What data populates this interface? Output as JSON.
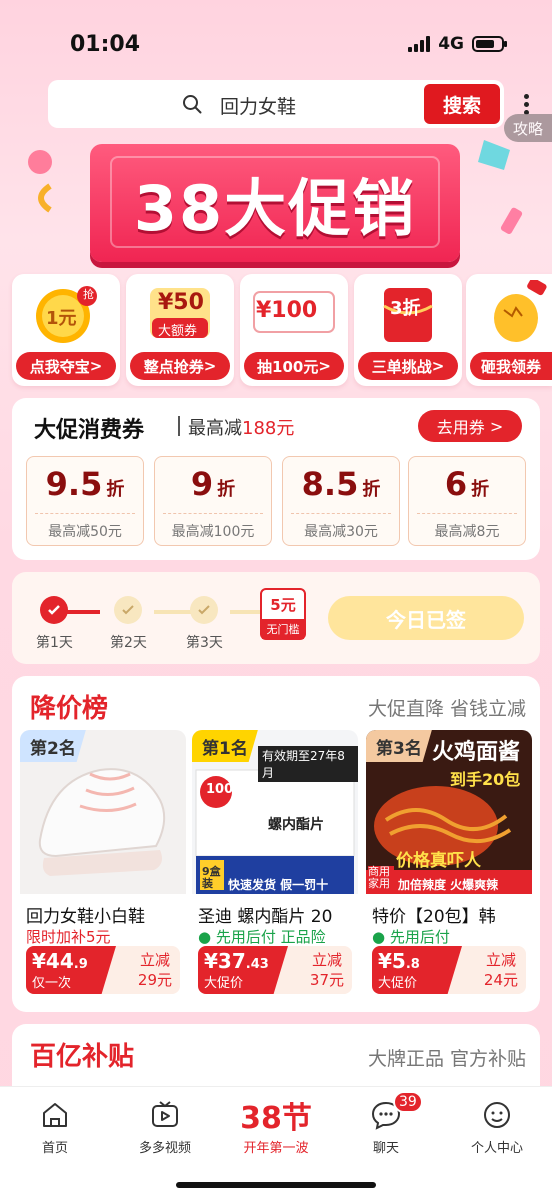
{
  "status": {
    "time": "01:04",
    "network": "4G"
  },
  "search": {
    "query": "回力女鞋",
    "button": "搜索",
    "guide": "攻略"
  },
  "banner": {
    "title": "38大促销"
  },
  "quick_entries": [
    {
      "label": "点我夺宝",
      "icon_text": "1元",
      "icon_sub": "抢",
      "icon": "coin-icon"
    },
    {
      "label": "整点抢券",
      "icon_text": "¥50",
      "icon_sub": "大额券",
      "icon": "coupon-icon"
    },
    {
      "label": "抽100元",
      "icon_text": "¥100",
      "icon": "cash-icon"
    },
    {
      "label": "三单挑战",
      "icon_text": "3折",
      "icon": "red-envelope-icon"
    },
    {
      "label": "砸我领券",
      "icon": "golden-egg-icon"
    }
  ],
  "coupons": {
    "title": "大促消费券",
    "subtitle_prefix": "最高减",
    "subtitle_value": "188元",
    "button": "去用券",
    "items": [
      {
        "discount": "9.5",
        "unit": "折",
        "max": "最高减50元"
      },
      {
        "discount": "9",
        "unit": "折",
        "max": "最高减100元"
      },
      {
        "discount": "8.5",
        "unit": "折",
        "max": "最高减30元"
      },
      {
        "discount": "6",
        "unit": "折",
        "max": "最高减8元"
      }
    ]
  },
  "signin": {
    "days": [
      "第1天",
      "第2天",
      "第3天"
    ],
    "reward_amount": "5元",
    "reward_label": "无门槛",
    "button": "今日已签"
  },
  "ranking": {
    "title": "降价榜",
    "subtitle": "大促直降  省钱立减",
    "products": [
      {
        "rank": "第2名",
        "name": "回力女鞋小白鞋",
        "tag": "限时加补5元",
        "price": "¥44",
        "price_decimal": ".9",
        "price_label": "仅一次",
        "cut_label": "立减",
        "cut_value": "29元"
      },
      {
        "rank": "第1名",
        "name": "圣迪 螺内酯片 20",
        "tag": "先用后付  正品险",
        "price": "¥37",
        "price_decimal": ".43",
        "price_label": "大促价",
        "cut_label": "立减",
        "cut_value": "37元",
        "img_text": "螺内酯片",
        "img_top": "有效期至27年8月",
        "img_badge": "100",
        "img_bottom": "快速发货 假一罚十",
        "img_pack": "9盒装"
      },
      {
        "rank": "第3名",
        "name": "特价【20包】韩",
        "tag": "先用后付",
        "price": "¥5",
        "price_decimal": ".8",
        "price_label": "大促价",
        "cut_label": "立减",
        "cut_value": "24元",
        "img_title": "火鸡面酱",
        "img_sub": "到手20包",
        "img_mid": "价格真吓人",
        "img_bottom": "加倍辣度 火爆爽辣",
        "img_corner": "商用家用"
      }
    ]
  },
  "subsidy": {
    "title": "百亿补贴",
    "subtitle": "大牌正品  官方补贴"
  },
  "tabbar": {
    "items": [
      {
        "label": "首页",
        "icon": "home-icon"
      },
      {
        "label": "多多视频",
        "icon": "video-icon"
      },
      {
        "label": "开年第一波",
        "icon": "festival-icon",
        "big": "38节"
      },
      {
        "label": "聊天",
        "icon": "chat-icon",
        "badge": "39"
      },
      {
        "label": "个人中心",
        "icon": "profile-icon"
      }
    ]
  },
  "colors": {
    "accent": "#e3242b",
    "background": "#ffd9e3",
    "gold": "#ffe59c"
  }
}
